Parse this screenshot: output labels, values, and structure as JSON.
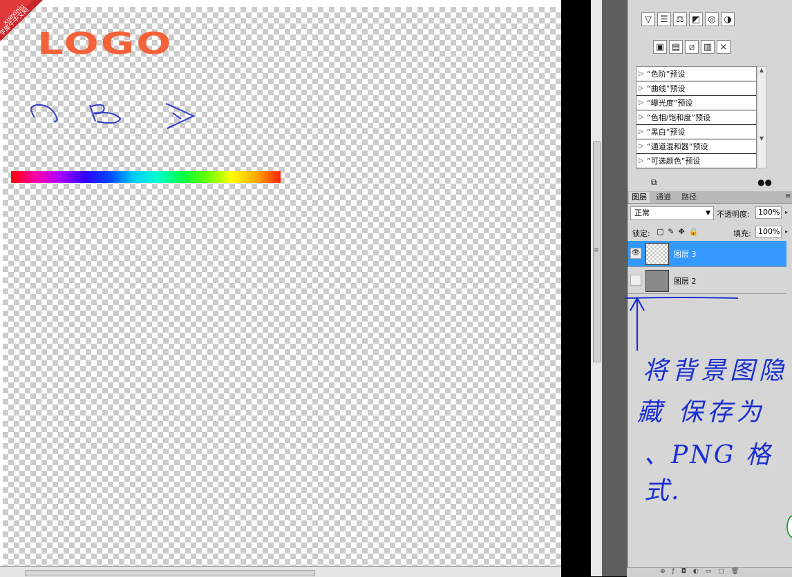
{
  "watermark": {
    "line1": "xuexiniu",
    "line2": "学犀牛中文网"
  },
  "canvas": {
    "logo_text": "LOGO",
    "handwritten_letters": [
      "C",
      "B",
      "A"
    ]
  },
  "adjustments_panel": {
    "presets": [
      "“色阶”预设",
      "“曲线”预设",
      "“曝光度”预设",
      "“色相/饱和度”预设",
      "“黑白”预设",
      "“通道混和器”预设",
      "“可选颜色”预设"
    ]
  },
  "layers_panel": {
    "tabs": [
      "图层",
      "通道",
      "路径"
    ],
    "blend_mode": "正常",
    "opacity_label": "不透明度:",
    "opacity_value": "100%",
    "lock_label": "锁定:",
    "fill_label": "填充:",
    "fill_value": "100%",
    "layers": [
      {
        "name": "图层 3",
        "selected": true,
        "visible": true
      },
      {
        "name": "图层 2",
        "selected": false,
        "visible": false
      }
    ]
  },
  "annotation": {
    "lines": [
      "将背景图隐",
      "藏 保存为",
      "、PNG 格式."
    ],
    "color": "#1a2fd1"
  },
  "colors": {
    "logo": "#f4623a",
    "selection": "#3399ff"
  }
}
